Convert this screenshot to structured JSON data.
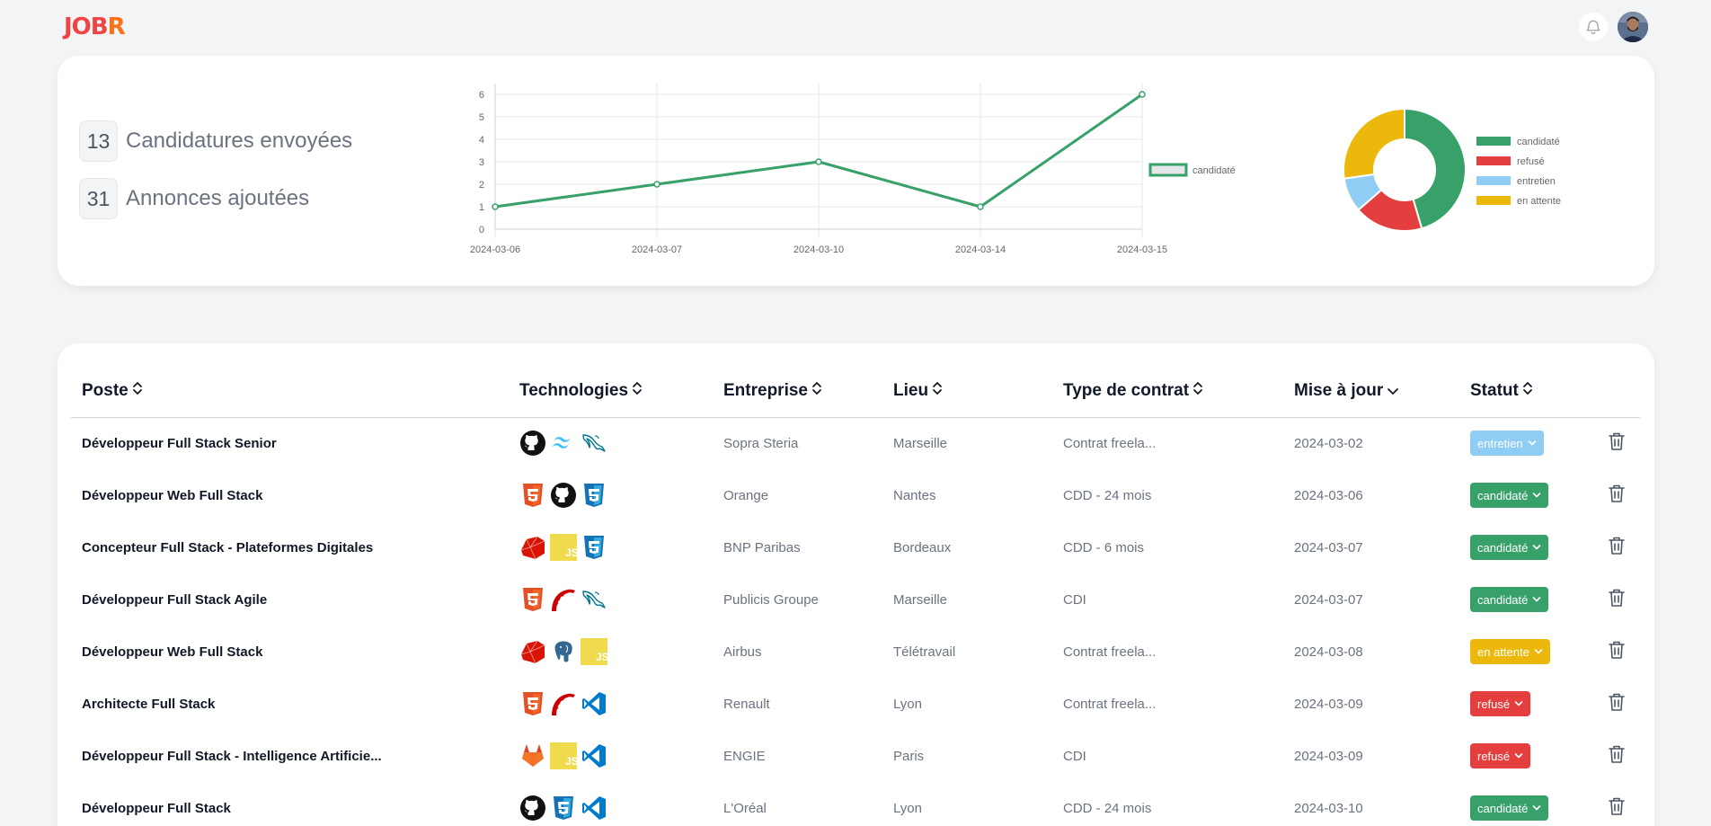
{
  "app": {
    "logo_part1": "JOB",
    "logo_part2": "R"
  },
  "icons": {
    "notifications": "bell-icon",
    "user": "avatar"
  },
  "stats": [
    {
      "value": "13",
      "label": "Candidatures envoyées"
    },
    {
      "value": "31",
      "label": "Annonces ajoutées"
    }
  ],
  "chart_data": [
    {
      "type": "line",
      "x": [
        "2024-03-06",
        "2024-03-07",
        "2024-03-10",
        "2024-03-14",
        "2024-03-15"
      ],
      "series": [
        {
          "name": "candidaté",
          "values": [
            1,
            2,
            3,
            1,
            6
          ],
          "color": "#38a169"
        }
      ],
      "ylim": [
        0,
        6
      ],
      "yticks": [
        "0",
        "1",
        "2",
        "3",
        "4",
        "5",
        "6"
      ],
      "grid": true,
      "legend": "right"
    },
    {
      "type": "pie",
      "donut": true,
      "labels": [
        "candidaté",
        "refusé",
        "entretien",
        "en attente"
      ],
      "values": [
        5,
        2,
        1,
        3
      ],
      "colors": [
        "#38a169",
        "#e53e3e",
        "#90cdf4",
        "#ecb80c"
      ],
      "legend": "right"
    }
  ],
  "table": {
    "headers": [
      {
        "label": "Poste",
        "sort": "both"
      },
      {
        "label": "Technologies",
        "sort": "both"
      },
      {
        "label": "Entreprise",
        "sort": "both"
      },
      {
        "label": "Lieu",
        "sort": "both"
      },
      {
        "label": "Type de contrat",
        "sort": "both"
      },
      {
        "label": "Mise à jour",
        "sort": "desc"
      },
      {
        "label": "Statut",
        "sort": "both"
      }
    ],
    "rows": [
      {
        "poste": "Développeur Full Stack Senior",
        "techs": [
          "github-icon",
          "tailwind-icon",
          "mysql-icon"
        ],
        "entreprise": "Sopra Steria",
        "lieu": "Marseille",
        "contrat": "Contrat freela...",
        "date": "2024-03-02",
        "statut": "entretien"
      },
      {
        "poste": "Développeur Web Full Stack",
        "techs": [
          "html5-icon",
          "github-icon",
          "css3-icon"
        ],
        "entreprise": "Orange",
        "lieu": "Nantes",
        "contrat": "CDD - 24 mois",
        "date": "2024-03-06",
        "statut": "candidaté"
      },
      {
        "poste": "Concepteur Full Stack - Plateformes Digitales",
        "techs": [
          "ruby-icon",
          "javascript-icon",
          "css3-icon"
        ],
        "entreprise": "BNP Paribas",
        "lieu": "Bordeaux",
        "contrat": "CDD - 6 mois",
        "date": "2024-03-07",
        "statut": "candidaté"
      },
      {
        "poste": "Développeur Full Stack Agile",
        "techs": [
          "html5-icon",
          "rails-icon",
          "mysql-icon"
        ],
        "entreprise": "Publicis Groupe",
        "lieu": "Marseille",
        "contrat": "CDI",
        "date": "2024-03-07",
        "statut": "candidaté"
      },
      {
        "poste": "Développeur Web Full Stack",
        "techs": [
          "ruby-icon",
          "postgresql-icon",
          "javascript-icon"
        ],
        "entreprise": "Airbus",
        "lieu": "Télétravail",
        "contrat": "Contrat freela...",
        "date": "2024-03-08",
        "statut": "en attente"
      },
      {
        "poste": "Architecte Full Stack",
        "techs": [
          "html5-icon",
          "rails-icon",
          "vscode-icon"
        ],
        "entreprise": "Renault",
        "lieu": "Lyon",
        "contrat": "Contrat freela...",
        "date": "2024-03-09",
        "statut": "refusé"
      },
      {
        "poste": "Développeur Full Stack - Intelligence Artificie...",
        "techs": [
          "gitlab-icon",
          "javascript-icon",
          "vscode-icon"
        ],
        "entreprise": "ENGIE",
        "lieu": "Paris",
        "contrat": "CDI",
        "date": "2024-03-09",
        "statut": "refusé"
      },
      {
        "poste": "Développeur Full Stack",
        "techs": [
          "github-icon",
          "css3-icon",
          "vscode-icon"
        ],
        "entreprise": "L'Oréal",
        "lieu": "Lyon",
        "contrat": "CDD - 24 mois",
        "date": "2024-03-10",
        "statut": "candidaté"
      }
    ]
  },
  "status_colors": {
    "candidaté": "#38a169",
    "refusé": "#e53e3e",
    "entretien": "#90cdf4",
    "en attente": "#ecb80c"
  }
}
